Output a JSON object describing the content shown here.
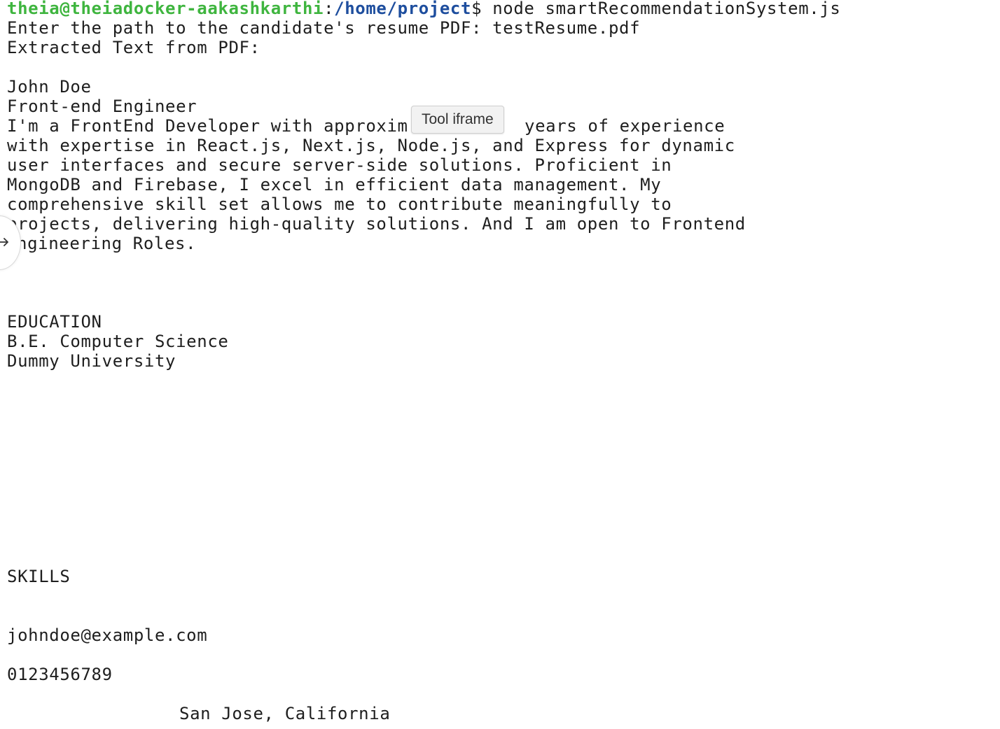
{
  "prompt": {
    "user_host": "theia@theiadocker-aakashkarthi",
    "separator": ":",
    "path": "/home/project",
    "symbol": "$",
    "command": " node smartRecommendationSystem.js"
  },
  "output": {
    "line1": "Enter the path to the candidate's resume PDF: testResume.pdf",
    "line2": "Extracted Text from PDF:",
    "name": "John Doe",
    "role": "Front-end Engineer",
    "summary_1": "I'm a FrontEnd Developer with approxim",
    "summary_1_tail": "years of experience",
    "summary_2": "with expertise in React.js, Next.js, Node.js, and Express for dynamic",
    "summary_3": "user interfaces and secure server-side solutions. Proficient in",
    "summary_4": "MongoDB and Firebase, I excel in efficient data management. My",
    "summary_5": "comprehensive skill set allows me to contribute meaningfully to",
    "summary_6": "projects, delivering high-quality solutions. And I am open to Frontend",
    "summary_7": "ngineering Roles.",
    "education_heading": "EDUCATION",
    "degree": "B.E. Computer Science",
    "university": "Dummy University",
    "skills_heading": "SKILLS",
    "email": "johndoe@example.com",
    "phone": "0123456789",
    "location": "San Jose, California"
  },
  "tooltip": {
    "text": "Tool iframe"
  },
  "side_button": {
    "icon": "arrow-right-icon"
  }
}
